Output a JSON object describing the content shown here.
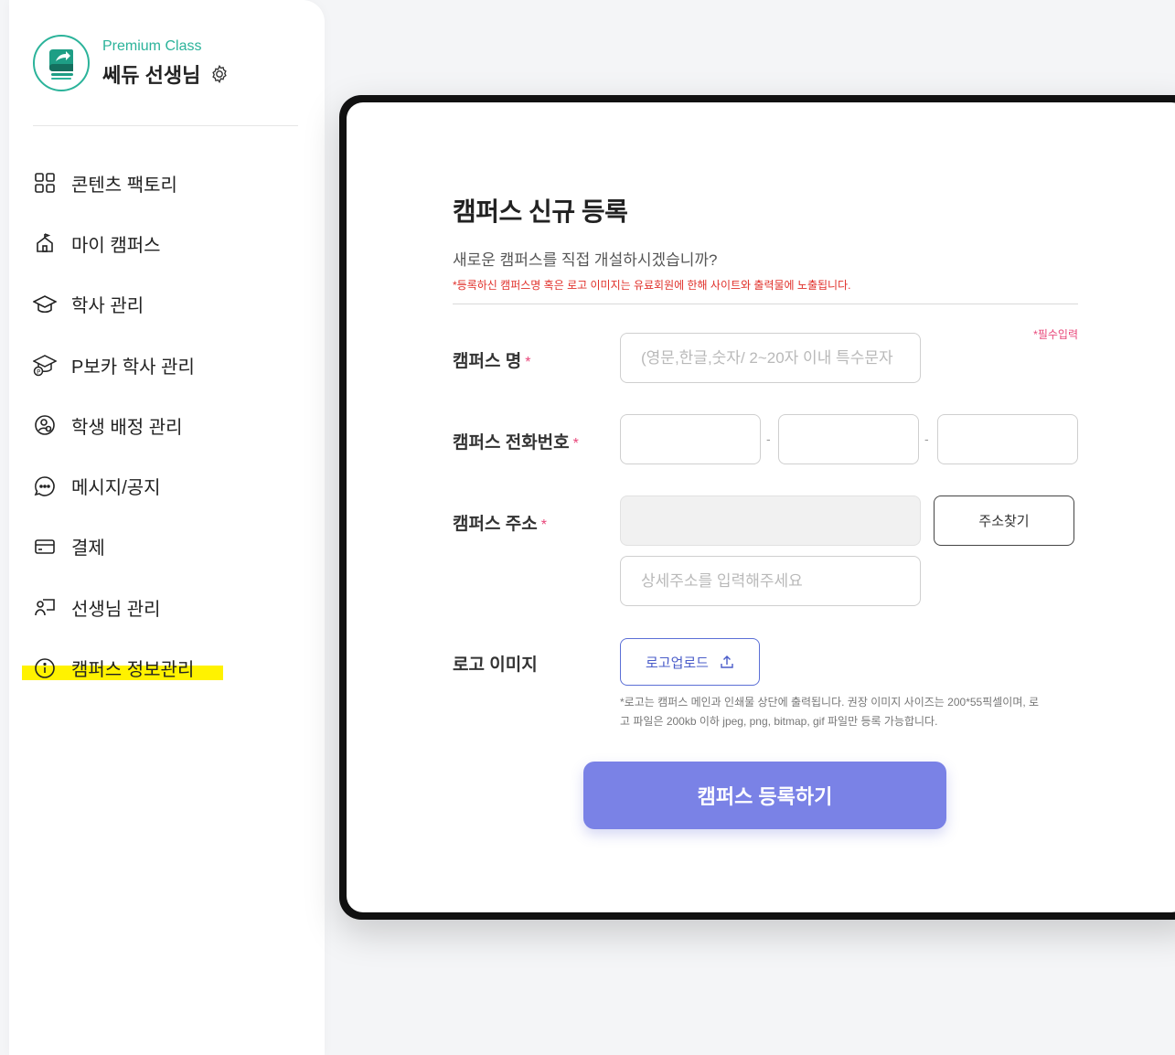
{
  "sidebar": {
    "profile": {
      "class_label": "Premium Class",
      "name": "쎄듀 선생님"
    },
    "menu": [
      {
        "label": "콘텐츠 팩토리",
        "icon": "grid-icon"
      },
      {
        "label": "마이 캠퍼스",
        "icon": "campus-icon"
      },
      {
        "label": "학사 관리",
        "icon": "graduation-cap-icon"
      },
      {
        "label": "P보카 학사 관리",
        "icon": "graduation-cap-p-icon"
      },
      {
        "label": "학생 배정 관리",
        "icon": "student-assign-icon"
      },
      {
        "label": "메시지/공지",
        "icon": "chat-bubble-icon"
      },
      {
        "label": "결제",
        "icon": "credit-card-icon"
      },
      {
        "label": "선생님 관리",
        "icon": "teacher-icon"
      },
      {
        "label": "캠퍼스 정보관리",
        "icon": "info-icon",
        "active": true
      }
    ]
  },
  "form": {
    "title": "캠퍼스 신규 등록",
    "subtitle": "새로운 캠퍼스를 직접 개설하시겠습니까?",
    "notice": "*등록하신 캠퍼스명 혹은 로고 이미지는 유료회원에 한해 사이트와 출력물에 노출됩니다.",
    "required_note": "*필수입력",
    "name_label": "캠퍼스 명",
    "name_placeholder": "(영문,한글,숫자/ 2~20자 이내 특수문자",
    "phone_label": "캠퍼스 전화번호",
    "phone_separator": "-",
    "address_label": "캠퍼스 주소",
    "address_search_button": "주소찾기",
    "address_detail_placeholder": "상세주소를 입력해주세요",
    "required_mark": "*",
    "logo_label": "로고 이미지",
    "logo_upload_button": "로고업로드",
    "logo_hint_line1": "*로고는 캠퍼스 메인과 인쇄물 상단에 출력됩니다. 권장 이미지 사이즈는 200*55픽셀이며, 로",
    "logo_hint_line2": "고 파일은 200kb 이하 jpeg, png, bitmap, gif 파일만 등록 가능합니다.",
    "submit_button": "캠퍼스 등록하기"
  },
  "colors": {
    "brand_green": "#2bb39a",
    "submit_purple": "#7a82e6",
    "required_pink": "#e8477a",
    "notice_red": "#e0302a",
    "highlight_yellow": "#fff200"
  }
}
